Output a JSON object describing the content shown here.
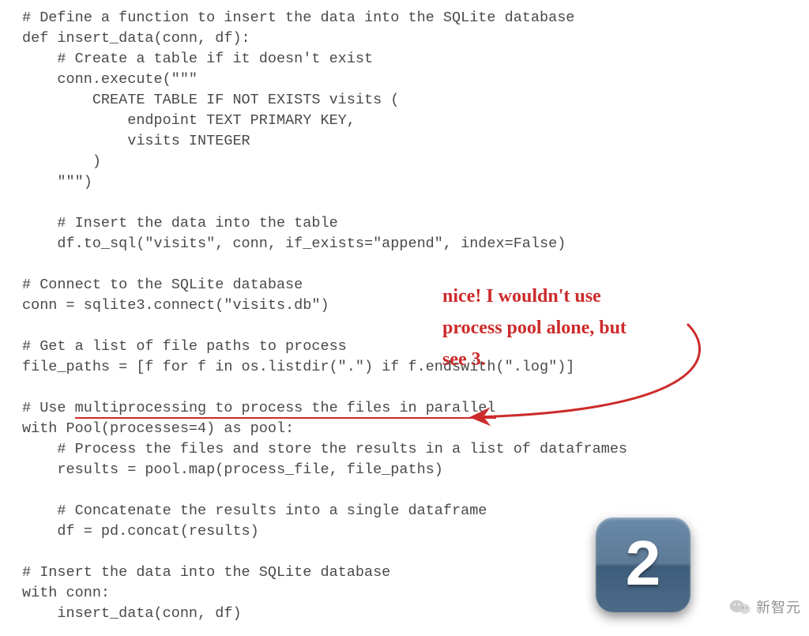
{
  "code": {
    "l1": "# Define a function to insert the data into the SQLite database",
    "l2": "def insert_data(conn, df):",
    "l3": "    # Create a table if it doesn't exist",
    "l4": "    conn.execute(\"\"\"",
    "l5": "        CREATE TABLE IF NOT EXISTS visits (",
    "l6": "            endpoint TEXT PRIMARY KEY,",
    "l7": "            visits INTEGER",
    "l8": "        )",
    "l9": "    \"\"\")",
    "l10": "",
    "l11": "    # Insert the data into the table",
    "l12": "    df.to_sql(\"visits\", conn, if_exists=\"append\", index=False)",
    "l13": "",
    "l14": "# Connect to the SQLite database",
    "l15": "conn = sqlite3.connect(\"visits.db\")",
    "l16": "",
    "l17": "# Get a list of file paths to process",
    "l18": "file_paths = [f for f in os.listdir(\".\") if f.endswith(\".log\")]",
    "l19": "",
    "l20_pre": "# Use ",
    "l20_ul": "multiprocessing to process the files in parallel",
    "l21": "with Pool(processes=4) as pool:",
    "l22": "    # Process the files and store the results in a list of dataframes",
    "l23": "    results = pool.map(process_file, file_paths)",
    "l24": "",
    "l25": "    # Concatenate the results into a single dataframe",
    "l26": "    df = pd.concat(results)",
    "l27": "",
    "l28": "# Insert the data into the SQLite database",
    "l29": "with conn:",
    "l30": "    insert_data(conn, df)"
  },
  "annotation": {
    "line1": "nice! I wouldn't use",
    "line2": "process pool alone, but",
    "line3": "see 3."
  },
  "badge": {
    "number": "2"
  },
  "watermark": {
    "text": "新智元"
  },
  "colors": {
    "annotation": "#cc2b2b",
    "code_text": "#4a4a4a",
    "badge_bg": "#5d7a96"
  }
}
